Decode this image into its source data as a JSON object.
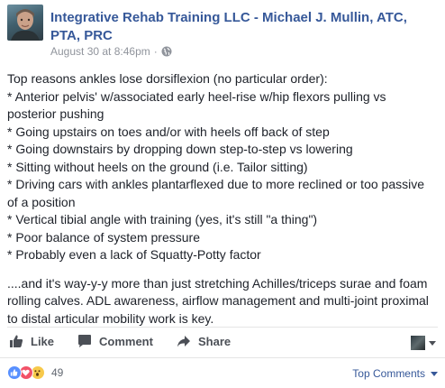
{
  "post": {
    "author": "Integrative Rehab Training LLC - Michael J. Mullin, ATC, PTA, PRC",
    "timestamp": "August 30 at 8:46pm",
    "separator": "·",
    "privacy_icon": "globe-icon",
    "lines": [
      "Top reasons ankles lose dorsiflexion (no particular order):",
      "* Anterior pelvis' w/associated early heel-rise w/hip flexors pulling vs posterior pushing",
      "* Going upstairs on toes and/or with heels off back of step",
      "* Going downstairs by dropping down step-to-step vs lowering",
      "* Sitting without heels on the ground (i.e. Tailor sitting)",
      "* Driving cars with ankles plantarflexed due to more reclined or too passive of a position",
      "* Vertical tibial angle with training (yes, it's still \"a thing\")",
      "* Poor balance of system pressure",
      "* Probably even a lack of Squatty-Potty factor"
    ],
    "closing": "....and it's way-y-y more than just stretching Achilles/triceps surae and foam rolling calves. ADL awareness, airflow management and multi-joint proximal to distal articular mobility work is key."
  },
  "actions": {
    "like": "Like",
    "comment": "Comment",
    "share": "Share"
  },
  "reactions": {
    "types": [
      "like",
      "love",
      "wow"
    ],
    "count": "49"
  },
  "comments": {
    "sort_label": "Top Comments"
  },
  "colors": {
    "link": "#365899",
    "text": "#1d2129",
    "meta": "#90949c",
    "action": "#4b4f56"
  }
}
